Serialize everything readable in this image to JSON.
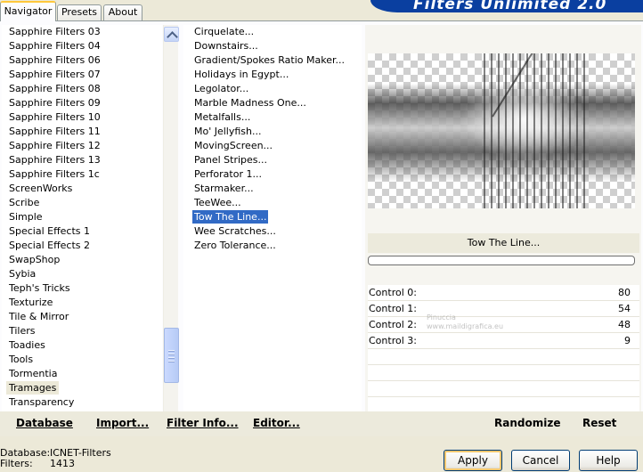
{
  "tabs": [
    "Navigator",
    "Presets",
    "About"
  ],
  "banner_title": "Filters Unlimited 2.0",
  "categories": [
    "Sapphire Filters 03",
    "Sapphire Filters 04",
    "Sapphire Filters 06",
    "Sapphire Filters 07",
    "Sapphire Filters 08",
    "Sapphire Filters 09",
    "Sapphire Filters 10",
    "Sapphire Filters 11",
    "Sapphire Filters 12",
    "Sapphire Filters 13",
    "Sapphire Filters 1c",
    "ScreenWorks",
    "Scribe",
    "Simple",
    "Special Effects 1",
    "Special Effects 2",
    "SwapShop",
    "Sybia",
    "Teph's Tricks",
    "Texturize",
    "Tile & Mirror",
    "Tilers",
    "Toadies",
    "Tools",
    "Tormentia",
    "Tramages",
    "Transparency"
  ],
  "selected_category": "Tramages",
  "filters": [
    "Cirquelate...",
    "Downstairs...",
    "Gradient/Spokes Ratio Maker...",
    "Holidays in Egypt...",
    "Legolator...",
    "Marble Madness One...",
    "Metalfalls...",
    "Mo' Jellyfish...",
    "MovingScreen...",
    "Panel Stripes...",
    "Perforator 1...",
    "Starmaker...",
    "TeeWee...",
    "Tow The Line...",
    "Wee Scratches...",
    "Zero Tolerance..."
  ],
  "selected_filter": "Tow The Line...",
  "filter_name": "Tow The Line...",
  "controls": [
    {
      "label": "Control 0:",
      "value": "80"
    },
    {
      "label": "Control 1:",
      "value": "54"
    },
    {
      "label": "Control 2:",
      "value": "48"
    },
    {
      "label": "Control 3:",
      "value": "9"
    }
  ],
  "watermark": {
    "line1": "Pinuccia",
    "line2": "www.maildigrafica.eu"
  },
  "bottom_bar": {
    "database": "Database",
    "import": "Import...",
    "filter_info": "Filter Info...",
    "editor": "Editor...",
    "randomize": "Randomize",
    "reset": "Reset"
  },
  "footer": {
    "database_label": "Database:",
    "database_value": "ICNET-Filters",
    "filters_label": "Filters:",
    "filters_value": "1413"
  },
  "buttons": {
    "apply": "Apply",
    "cancel": "Cancel",
    "help": "Help"
  },
  "colors": {
    "selection": "#316ac5",
    "banner": "#0a3fa0",
    "face": "#ece9d8"
  }
}
